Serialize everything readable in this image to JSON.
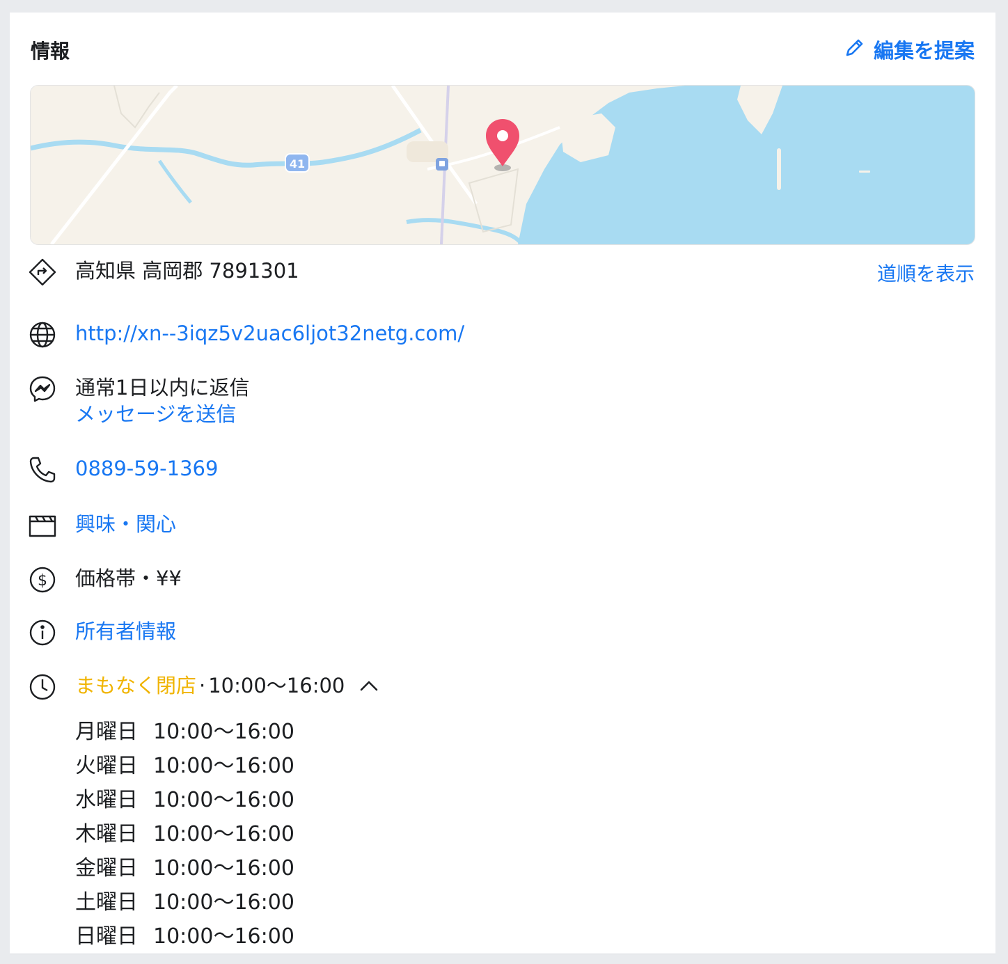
{
  "header": {
    "title": "情報",
    "suggest_label": "編集を提案"
  },
  "map": {
    "road_badge": "41",
    "water_color": "#a8dbf2",
    "land_color": "#f6f2ea",
    "pin_color": "#f0506e"
  },
  "address": {
    "text": "高知県 高岡郡 7891301",
    "directions_label": "道順を表示"
  },
  "website": {
    "url": "http://xn--3iqz5v2uac6ljot32netg.com/"
  },
  "messenger": {
    "reply_time": "通常1日以内に返信",
    "send_label": "メッセージを送信"
  },
  "phone": {
    "number": "0889-59-1369"
  },
  "interests": {
    "label": "興味・関心"
  },
  "price": {
    "label": "価格帯・¥¥"
  },
  "owner": {
    "label": "所有者情報"
  },
  "hours": {
    "status": "まもなく閉店",
    "separator": "·",
    "today": "10:00〜16:00",
    "days": [
      {
        "day": "月曜日",
        "time": "10:00〜16:00"
      },
      {
        "day": "火曜日",
        "time": "10:00〜16:00"
      },
      {
        "day": "水曜日",
        "time": "10:00〜16:00"
      },
      {
        "day": "木曜日",
        "time": "10:00〜16:00"
      },
      {
        "day": "金曜日",
        "time": "10:00〜16:00"
      },
      {
        "day": "土曜日",
        "time": "10:00〜16:00"
      },
      {
        "day": "日曜日",
        "time": "10:00〜16:00"
      }
    ]
  },
  "colors": {
    "link": "#1877f2",
    "warning": "#f0b400",
    "text": "#1c1e21"
  }
}
